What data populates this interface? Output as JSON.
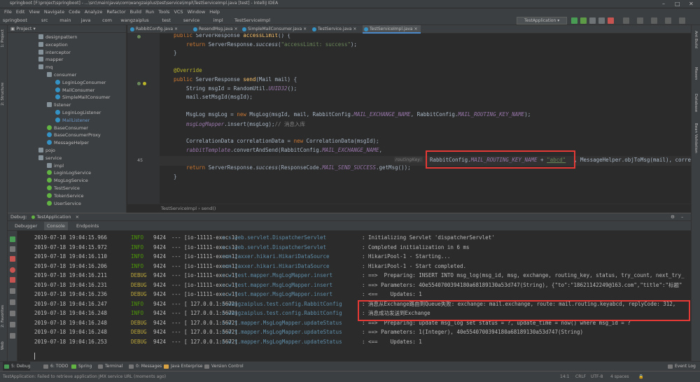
{
  "window": {
    "title": "springboot [F:\\project\\springboot] - ...\\src\\main\\java\\com\\wangzaiplus\\test\\service\\impl\\TestServiceImpl.java [test] - IntelliJ IDEA"
  },
  "menu": [
    "File",
    "Edit",
    "View",
    "Navigate",
    "Code",
    "Analyze",
    "Refactor",
    "Build",
    "Run",
    "Tools",
    "VCS",
    "Window",
    "Help"
  ],
  "breadcrumbs": [
    "springboot",
    "src",
    "main",
    "java",
    "com",
    "wangzaiplus",
    "test",
    "service",
    "impl",
    "TestServiceImpl"
  ],
  "run_config": "TestApplication",
  "tool_windows": {
    "left": [
      "1: Project",
      "2: Structure",
      "2: Favorites",
      "Web"
    ],
    "right": [
      "Ant Build",
      "Maven",
      "Database",
      "Bean Validation"
    ]
  },
  "project_panel": {
    "title": "Project",
    "items": [
      {
        "label": "designpattern",
        "type": "folder",
        "depth": 1
      },
      {
        "label": "exception",
        "type": "folder",
        "depth": 1
      },
      {
        "label": "interceptor",
        "type": "folder",
        "depth": 1
      },
      {
        "label": "mapper",
        "type": "folder",
        "depth": 1
      },
      {
        "label": "mq",
        "type": "folder",
        "depth": 1
      },
      {
        "label": "consumer",
        "type": "folder",
        "depth": 2
      },
      {
        "label": "LoginLogConsumer",
        "type": "class",
        "depth": 3
      },
      {
        "label": "MailConsumer",
        "type": "class",
        "depth": 3
      },
      {
        "label": "SimpleMailConsumer",
        "type": "class",
        "depth": 3
      },
      {
        "label": "listener",
        "type": "folder",
        "depth": 2
      },
      {
        "label": "LoginLogListener",
        "type": "class",
        "depth": 3
      },
      {
        "label": "MailListener",
        "type": "class",
        "depth": 3
      },
      {
        "label": "BaseConsumer",
        "type": "interface",
        "depth": 2
      },
      {
        "label": "BaseConsumerProxy",
        "type": "class",
        "depth": 2
      },
      {
        "label": "MessageHelper",
        "type": "class",
        "depth": 2
      },
      {
        "label": "pojo",
        "type": "folder",
        "depth": 1
      },
      {
        "label": "service",
        "type": "folder",
        "depth": 1
      },
      {
        "label": "impl",
        "type": "folder",
        "depth": 2
      },
      {
        "label": "LoginLogService",
        "type": "interface",
        "depth": 2
      },
      {
        "label": "MsgLogService",
        "type": "interface",
        "depth": 2
      },
      {
        "label": "TestService",
        "type": "interface",
        "depth": 2
      },
      {
        "label": "TokenService",
        "type": "interface",
        "depth": 2
      },
      {
        "label": "UserService",
        "type": "interface",
        "depth": 2
      }
    ]
  },
  "editor_tabs": [
    "RabbitConfig.java",
    "ResendMsg.java",
    "SimpleMailConsumer.java",
    "TestService.java",
    "TestServiceImpl.java"
  ],
  "active_editor_tab": "TestServiceImpl.java",
  "code": {
    "line_45": "45",
    "lines": [
      {
        "frag": [
          [
            "kw",
            "public "
          ],
          [
            "",
            "ServerResponse "
          ],
          [
            "mth",
            "accessLimit"
          ],
          [
            "",
            "() {"
          ]
        ]
      },
      {
        "frag": [
          [
            "",
            "    "
          ],
          [
            "kw",
            "return "
          ],
          [
            "",
            "ServerResponse."
          ],
          [
            "sfun",
            "success"
          ],
          [
            "",
            "("
          ],
          [
            "str",
            "\"accessLimit: success\""
          ],
          [
            "",
            ");"
          ]
        ]
      },
      {
        "frag": [
          [
            "",
            "}"
          ]
        ]
      },
      {
        "frag": []
      },
      {
        "frag": [
          [
            "ann",
            "@Override"
          ]
        ]
      },
      {
        "frag": [
          [
            "kw",
            "public "
          ],
          [
            "",
            "ServerResponse "
          ],
          [
            "mth",
            "send"
          ],
          [
            "",
            "(Mail mail) {"
          ]
        ]
      },
      {
        "frag": [
          [
            "",
            "    String msgId = RandomUtil."
          ],
          [
            "fld",
            "UUID32"
          ],
          [
            "",
            "();"
          ]
        ]
      },
      {
        "frag": [
          [
            "",
            "    mail.setMsgId(msgId);"
          ]
        ]
      },
      {
        "frag": []
      },
      {
        "frag": [
          [
            "",
            "    MsgLog msgLog = "
          ],
          [
            "kw",
            "new "
          ],
          [
            "",
            "MsgLog(msgId, mail, RabbitConfig."
          ],
          [
            "fld",
            "MAIL_EXCHANGE_NAME"
          ],
          [
            "",
            ", RabbitConfig."
          ],
          [
            "fld",
            "MAIL_ROUTING_KEY_NAME"
          ],
          [
            "",
            ");"
          ]
        ]
      },
      {
        "frag": [
          [
            "fld",
            "    msgLogMapper"
          ],
          [
            "",
            ".insert(msgLog);"
          ],
          [
            "cmt",
            "// 消息入库"
          ]
        ]
      },
      {
        "frag": []
      },
      {
        "frag": [
          [
            "",
            "    CorrelationData correlationData = "
          ],
          [
            "kw",
            "new "
          ],
          [
            "",
            "CorrelationData(msgId);"
          ]
        ]
      },
      {
        "frag": [
          [
            "fld",
            "    rabbitTemplate"
          ],
          [
            "",
            ".convertAndSend(RabbitConfig."
          ],
          [
            "fld",
            "MAIL_EXCHANGE_NAME"
          ],
          [
            "",
            ", "
          ]
        ]
      },
      {
        "frag": []
      },
      {
        "frag": [
          [
            "",
            "    "
          ],
          [
            "kw",
            "return "
          ],
          [
            "",
            "ServerResponse."
          ],
          [
            "sfun",
            "success"
          ],
          [
            "",
            "(ResponseCode."
          ],
          [
            "fld",
            "MAIL_SEND_SUCCESS"
          ],
          [
            "",
            ".getMsg());"
          ]
        ]
      },
      {
        "frag": [
          [
            "",
            "}"
          ]
        ]
      }
    ],
    "hint_routing_key": "routingKey:",
    "boxed_text": {
      "pre": "RabbitConfig.",
      "field": "MAIL_ROUTING_KEY_NAME",
      "mid": " + ",
      "str": "\"abcd\""
    },
    "after_box": ", MessageHelper.objToMsg(mail), corre"
  },
  "editor_breadcrumb": "TestServiceImpl  ›  send()",
  "debug": {
    "title": "Debug:",
    "config": "TestApplication",
    "tabs": [
      "Debugger",
      "Console",
      "Endpoints"
    ],
    "active_tab": "Console"
  },
  "console_rows": [
    {
      "ts": "2019-07-18 19:04:15.966",
      "lv": "INFO",
      "pid": "9424",
      "th": "--- [io-11111-exec-1]",
      "lg": "o.s.web.servlet.DispatcherServlet",
      "msg": ": Initializing Servlet 'dispatcherServlet'"
    },
    {
      "ts": "2019-07-18 19:04:15.972",
      "lv": "INFO",
      "pid": "9424",
      "th": "--- [io-11111-exec-1]",
      "lg": "o.s.web.servlet.DispatcherServlet",
      "msg": ": Completed initialization in 6 ms"
    },
    {
      "ts": "2019-07-18 19:04:16.110",
      "lv": "INFO",
      "pid": "9424",
      "th": "--- [io-11111-exec-1]",
      "lg": "com.zaxxer.hikari.HikariDataSource",
      "msg": ": HikariPool-1 - Starting..."
    },
    {
      "ts": "2019-07-18 19:04:16.206",
      "lv": "INFO",
      "pid": "9424",
      "th": "--- [io-11111-exec-1]",
      "lg": "com.zaxxer.hikari.HikariDataSource",
      "msg": ": HikariPool-1 - Start completed."
    },
    {
      "ts": "2019-07-18 19:04:16.211",
      "lv": "DEBUG",
      "pid": "9424",
      "th": "--- [io-11111-exec-1]",
      "lg": "c.w.test.mapper.MsgLogMapper.insert",
      "msg": ": ==>  Preparing: INSERT INTO msg_log(msg_id, msg, exchange, routing_key, status, try_count, next_try_"
    },
    {
      "ts": "2019-07-18 19:04:16.231",
      "lv": "DEBUG",
      "pid": "9424",
      "th": "--- [io-11111-exec-1]",
      "lg": "c.w.test.mapper.MsgLogMapper.insert",
      "msg": ": ==> Parameters: 40e5540700394180a68189130a53d747(String), {\"to\":\"18621142249@163.com\",\"title\":\"标题\""
    },
    {
      "ts": "2019-07-18 19:04:16.236",
      "lv": "DEBUG",
      "pid": "9424",
      "th": "--- [io-11111-exec-1]",
      "lg": "c.w.test.mapper.MsgLogMapper.insert",
      "msg": ": <==    Updates: 1"
    },
    {
      "ts": "2019-07-18 19:04:16.247",
      "lv": "INFO",
      "pid": "9424",
      "th": "--- [ 127.0.0.1:5672]",
      "lg": "c.wangzaiplus.test.config.RabbitConfig",
      "msg": ": 消息从Exchange路由到Queue失败: exchange: mail.exchange, route: mail.routing.keyabcd, replyCode: 312,"
    },
    {
      "ts": "2019-07-18 19:04:16.248",
      "lv": "INFO",
      "pid": "9424",
      "th": "--- [ 127.0.0.1:5672]",
      "lg": "c.wangzaiplus.test.config.RabbitConfig",
      "msg": ": 消息成功发送到Exchange"
    },
    {
      "ts": "2019-07-18 19:04:16.248",
      "lv": "DEBUG",
      "pid": "9424",
      "th": "--- [ 127.0.0.1:5672]",
      "lg": "c.w.t.mapper.MsgLogMapper.updateStatus",
      "msg": ": ==>  Preparing: update msg_log set status = ?, update_time = now() where msg_id = ?"
    },
    {
      "ts": "2019-07-18 19:04:16.248",
      "lv": "DEBUG",
      "pid": "9424",
      "th": "--- [ 127.0.0.1:5672]",
      "lg": "c.w.t.mapper.MsgLogMapper.updateStatus",
      "msg": ": ==> Parameters: 1(Integer), 40e5540700394180a68189130a53d747(String)"
    },
    {
      "ts": "2019-07-18 19:04:16.253",
      "lv": "DEBUG",
      "pid": "9424",
      "th": "--- [ 127.0.0.1:5672]",
      "lg": "c.w.t.mapper.MsgLogMapper.updateStatus",
      "msg": ": <==    Updates: 1"
    }
  ],
  "bottom_tabs": [
    "5: Debug",
    "6: TODO",
    "Spring",
    "Terminal",
    "0: Messages",
    "Java Enterprise",
    "Version Control"
  ],
  "event_log": "Event Log",
  "status": {
    "message": "TestApplication: Failed to retrieve application JMX service URL (moments ago)",
    "position": "14:1",
    "line_sep": "CRLF",
    "encoding": "UTF-8",
    "indent": "4 spaces"
  },
  "colors": {
    "highlight_box": "#e53935",
    "info": "#4e9a06",
    "debug": "#bca73a"
  }
}
